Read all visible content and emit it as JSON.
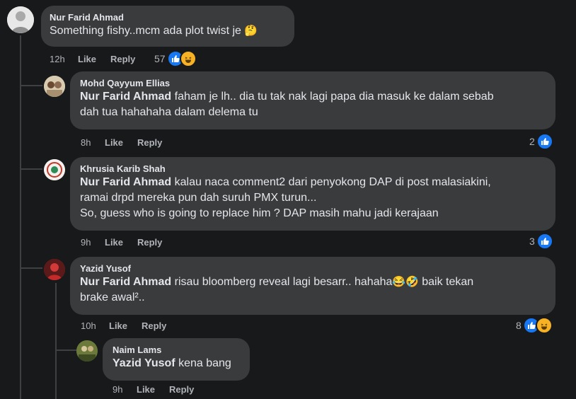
{
  "comments": [
    {
      "author": "Nur Farid Ahmad",
      "text": "Something fishy..mcm ada plot twist je",
      "emoji": "🤔",
      "time": "12h",
      "like": "Like",
      "reply": "Reply",
      "reaction_count": "57"
    },
    {
      "author": "Mohd Qayyum Ellias",
      "mention": "Nur Farid Ahmad",
      "text_line1": "faham je lh.. dia tu tak nak lagi papa dia masuk ke dalam sebab",
      "text_line2": "dah tua hahahaha dalam delema tu",
      "time": "8h",
      "like": "Like",
      "reply": "Reply",
      "reaction_count": "2"
    },
    {
      "author": "Khrusia Karib Shah",
      "mention": "Nur Farid Ahmad",
      "text_line1": "kalau naca comment2 dari penyokong DAP di post malasiakini,",
      "text_line2": "ramai drpd mereka pun dah suruh PMX turun...",
      "text_line3": "So, guess who is going to replace him ? DAP masih mahu jadi kerajaan",
      "time": "9h",
      "like": "Like",
      "reply": "Reply",
      "reaction_count": "3"
    },
    {
      "author": "Yazid Yusof",
      "mention": "Nur Farid Ahmad",
      "text_line1": "risau bloomberg reveal lagi besarr.. hahaha",
      "emoji": "😂🤣",
      "text_line1_tail": "baik tekan",
      "text_line2": "brake awal².. ",
      "time": "10h",
      "like": "Like",
      "reply": "Reply",
      "reaction_count": "8"
    },
    {
      "author": "Naim Lams",
      "mention": "Yazid Yusof",
      "text": "kena bang",
      "time": "9h",
      "like": "Like",
      "reply": "Reply"
    }
  ],
  "icons": {
    "like": "thumbs-up-icon",
    "haha": "haha-icon"
  },
  "colors": {
    "background": "#18191a",
    "bubble": "#3a3b3c",
    "like_blue": "#1877f2",
    "text": "#e4e6eb",
    "muted": "#b0b3b8"
  }
}
